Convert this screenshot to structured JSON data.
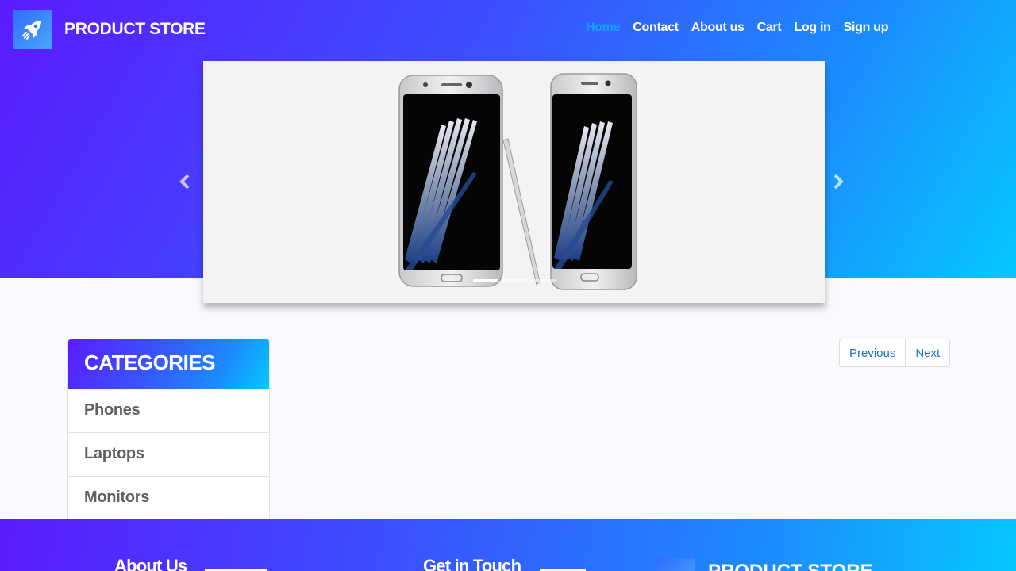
{
  "brand": {
    "name": "PRODUCT STORE",
    "logo_icon": "rocket-icon"
  },
  "nav": {
    "items": [
      {
        "label": "Home",
        "active": true
      },
      {
        "label": "Contact",
        "active": false
      },
      {
        "label": "About us",
        "active": false
      },
      {
        "label": "Cart",
        "active": false
      },
      {
        "label": "Log in",
        "active": false
      },
      {
        "label": "Sign up",
        "active": false
      }
    ]
  },
  "carousel": {
    "image": "samsung-galaxy-phones-with-stylus",
    "prev_icon": "chevron-left-icon",
    "next_icon": "chevron-right-icon",
    "slide_count": 3,
    "active_slide": 1
  },
  "categories": {
    "title": "CATEGORIES",
    "items": [
      "Phones",
      "Laptops",
      "Monitors"
    ]
  },
  "pagination": {
    "previous": "Previous",
    "next": "Next"
  },
  "footer": {
    "about_title": "About Us",
    "contact_title": "Get in Touch",
    "brand": "PRODUCT STORE"
  },
  "colors": {
    "gradient_start": "#5b1bff",
    "gradient_end": "#05c8ff",
    "nav_active": "#11a3ff",
    "link": "#1a6fc4"
  }
}
